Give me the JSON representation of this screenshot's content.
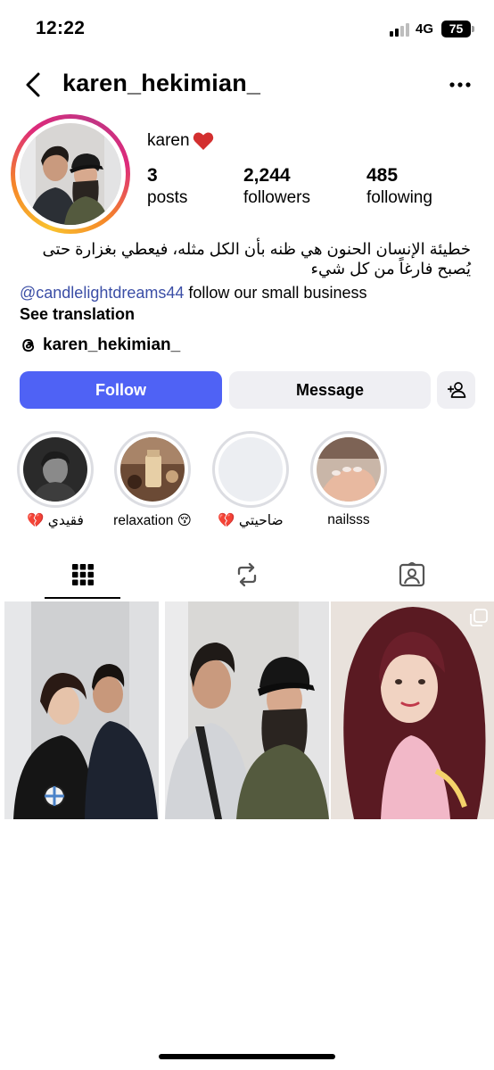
{
  "status_bar": {
    "time": "12:22",
    "network": "4G",
    "battery": "75"
  },
  "header": {
    "username": "karen_hekimian_"
  },
  "profile": {
    "display_name": "karen",
    "stats": [
      {
        "value": "3",
        "label": "posts"
      },
      {
        "value": "2,244",
        "label": "followers"
      },
      {
        "value": "485",
        "label": "following"
      }
    ],
    "bio_arabic": "خطيئة الإنسان الحنون هي ظنه بأن الكل مثله، فيعطي بغزارة حتى يُصبح فارغاً من كل شيء",
    "bio_mention": "@candlelightdreams44",
    "bio_text": " follow our small business",
    "see_translation": "See translation",
    "threads_handle": "karen_hekimian_"
  },
  "buttons": {
    "follow": "Follow",
    "message": "Message"
  },
  "highlights": [
    {
      "label": "💔 فقيدي"
    },
    {
      "label": "relaxation 😚"
    },
    {
      "label": "💔 ضاحيتي"
    },
    {
      "label": "nailsss"
    }
  ],
  "tabs": [
    {
      "icon": "grid-icon",
      "active": true
    },
    {
      "icon": "reels-repost-icon",
      "active": false
    },
    {
      "icon": "tagged-icon",
      "active": false
    }
  ],
  "posts": [
    {
      "icon": null
    },
    {
      "icon": null
    },
    {
      "icon": "multi-post-icon"
    }
  ]
}
